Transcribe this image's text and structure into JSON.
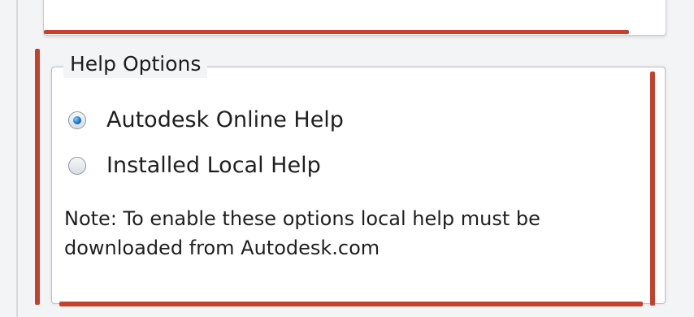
{
  "group_box": {
    "title": "Help Options"
  },
  "options": [
    {
      "label": "Autodesk Online Help",
      "selected": true
    },
    {
      "label": "Installed Local Help",
      "selected": false
    }
  ],
  "note": "Note: To enable these options local help must be downloaded from Autodesk.com",
  "colors": {
    "annotation_red": "#c5412b",
    "radio_selected": "#1a74c9"
  }
}
